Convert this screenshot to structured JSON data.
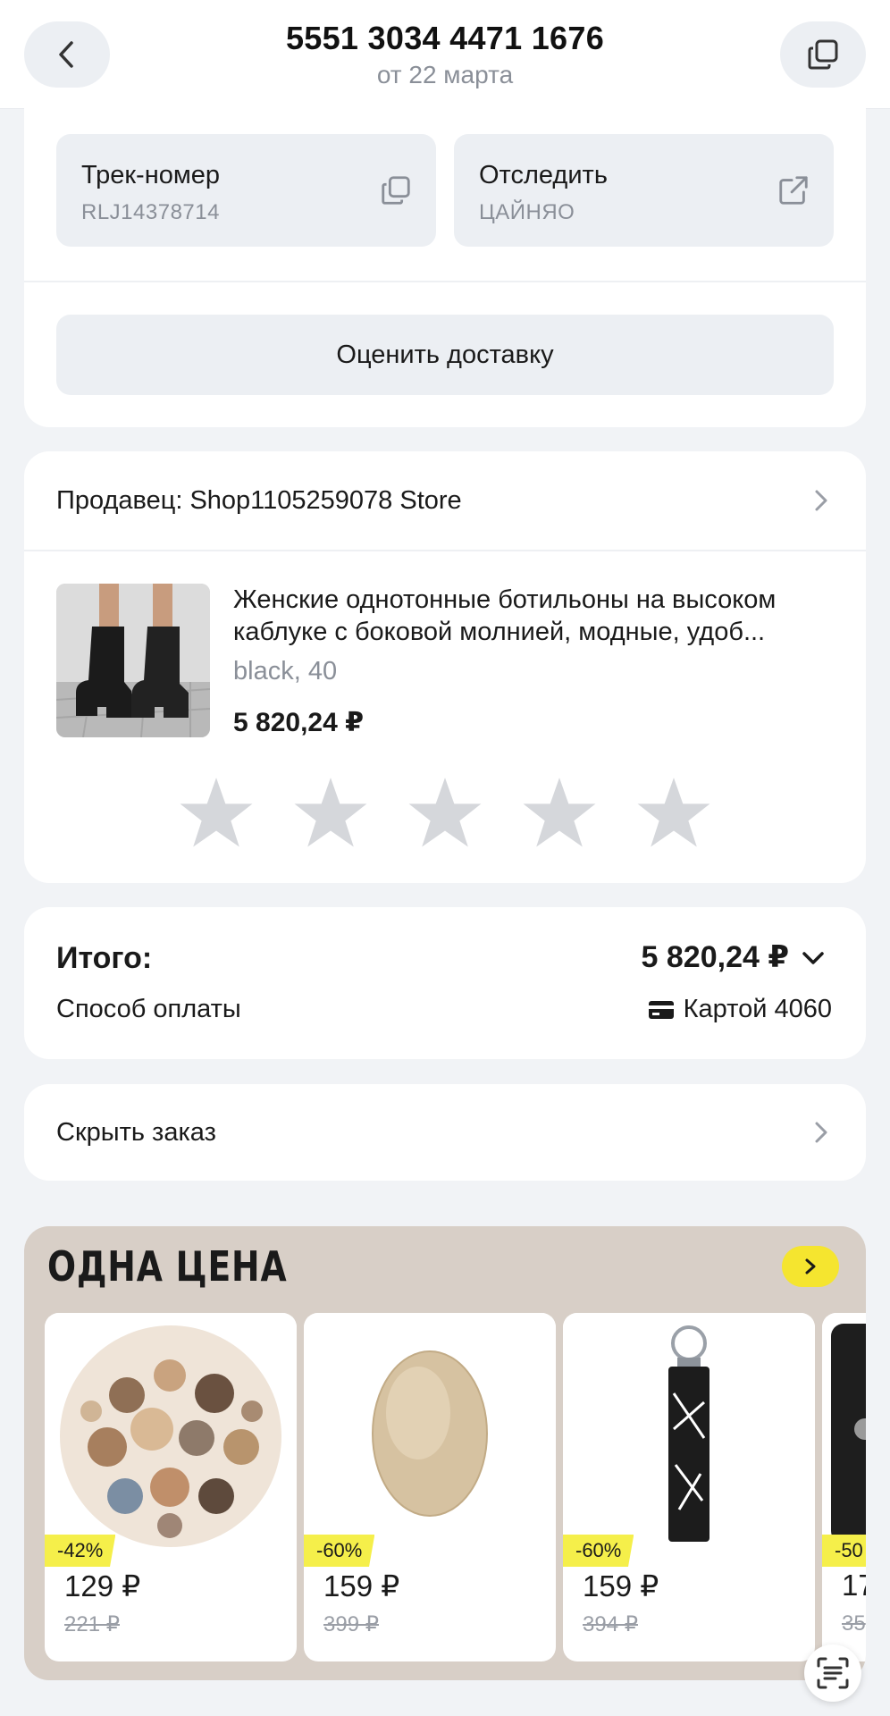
{
  "header": {
    "order_number": "5551 3034 4471 1676",
    "date": "от 22 марта"
  },
  "tracking": {
    "track_title": "Трек-номер",
    "track_value": "RLJ14378714",
    "follow_title": "Отследить",
    "follow_value": "ЦАЙНЯО",
    "rate_delivery": "Оценить доставку"
  },
  "seller": {
    "label": "Продавец: Shop1105259078 Store"
  },
  "product": {
    "title": "Женские однотонные ботильоны на высоком каблуке с боковой молнией, модные, удоб...",
    "variant": "black, 40",
    "price": "5 820,24 ₽",
    "rating": 0,
    "rating_max": 5
  },
  "summary": {
    "total_label": "Итого:",
    "total_value": "5 820,24 ₽",
    "payment_label": "Способ оплаты",
    "payment_value": "Картой 4060"
  },
  "hide_order": {
    "label": "Скрыть заказ"
  },
  "promo": {
    "title": "ОДНА ЦЕНА",
    "items": [
      {
        "discount": "-42%",
        "price": "129 ₽",
        "old_price": "221 ₽"
      },
      {
        "discount": "-60%",
        "price": "159 ₽",
        "old_price": "399 ₽"
      },
      {
        "discount": "-60%",
        "price": "159 ₽",
        "old_price": "394 ₽"
      },
      {
        "discount": "-50",
        "price": "17",
        "old_price": "35"
      }
    ]
  },
  "colors": {
    "background": "#f1f3f6",
    "card": "#ffffff",
    "chip": "#eceff3",
    "promo_bg": "#d8cfc7",
    "accent_yellow": "#f5e52f",
    "muted_text": "#8a8f98"
  }
}
